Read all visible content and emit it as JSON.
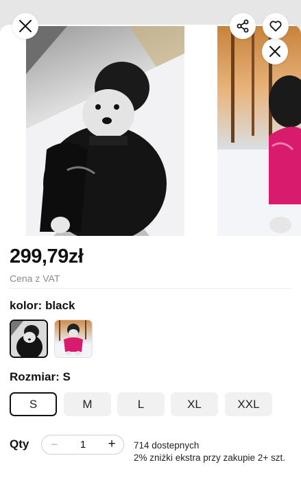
{
  "product": {
    "price": "299,79zł",
    "vat_note": "Cena z VAT",
    "color_label": "kolor: black",
    "colors": [
      {
        "name": "black",
        "selected": true
      },
      {
        "name": "pink",
        "selected": false
      }
    ],
    "size_label": "Rozmiar: S",
    "sizes": [
      {
        "label": "S",
        "selected": true
      },
      {
        "label": "M",
        "selected": false
      },
      {
        "label": "L",
        "selected": false
      },
      {
        "label": "XL",
        "selected": false
      },
      {
        "label": "XXL",
        "selected": false
      }
    ],
    "qty_label": "Qty",
    "qty_value": "1",
    "stock_text": "714 dostepnych",
    "discount_text": "2% zniżki ekstra przy zakupie 2+ szt."
  },
  "icons": {
    "close": "close-icon",
    "share": "share-icon",
    "favorite": "heart-icon",
    "minus": "minus-icon",
    "plus": "plus-icon"
  },
  "colors": {
    "jacket_black": "#111111",
    "jacket_pink": "#d81b6d",
    "selected_border": "#111111"
  }
}
